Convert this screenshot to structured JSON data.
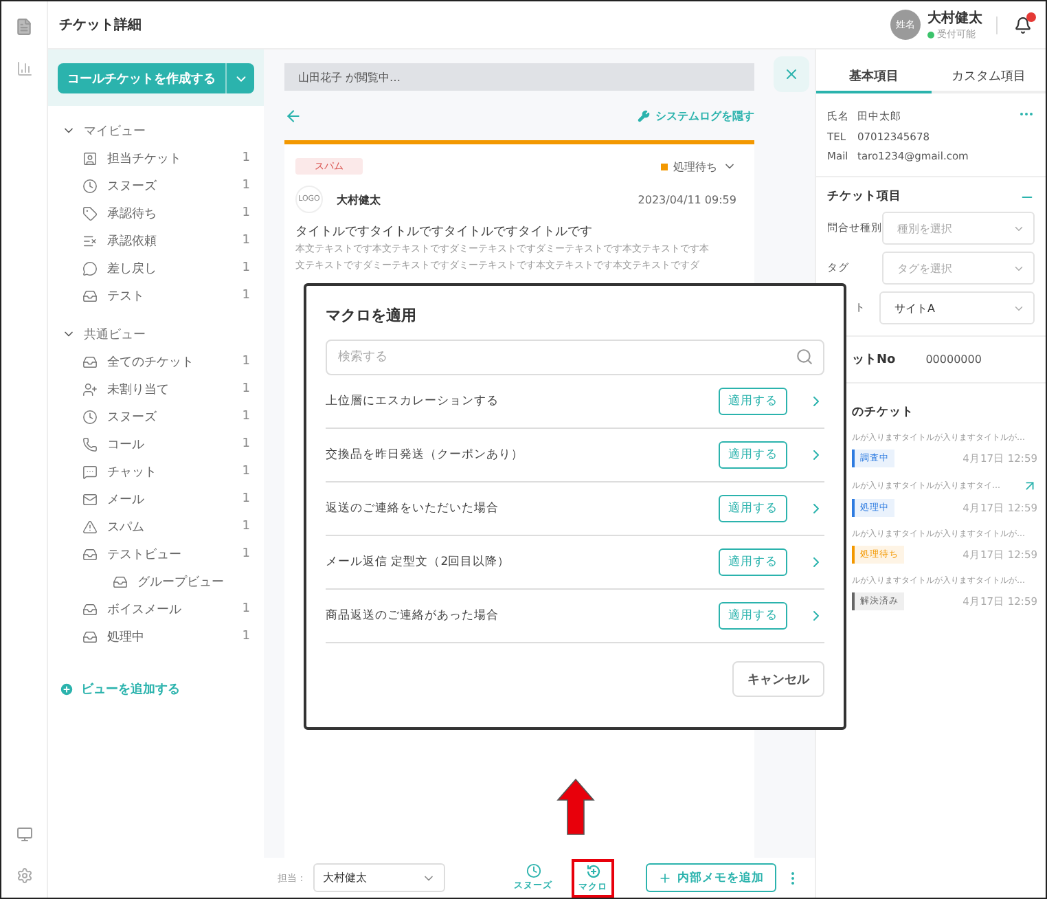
{
  "header": {
    "title": "チケット詳細",
    "user": {
      "avatar_text": "姓名",
      "name": "大村健太",
      "status": "受付可能"
    },
    "notification_unread": true
  },
  "sidebar": {
    "create_button": "コールチケットを作成する",
    "sections": [
      {
        "title": "マイビュー",
        "expanded": true,
        "items": [
          {
            "kind": "assigned",
            "label": "担当チケット",
            "count": "1"
          },
          {
            "kind": "snooze",
            "label": "スヌーズ",
            "count": "1"
          },
          {
            "kind": "pending",
            "label": "承認待ち",
            "count": "1"
          },
          {
            "kind": "request",
            "label": "承認依頼",
            "count": "1"
          },
          {
            "kind": "returned",
            "label": "差し戻し",
            "count": "1"
          },
          {
            "kind": "inbox",
            "label": "テスト",
            "count": "1"
          }
        ]
      },
      {
        "title": "共通ビュー",
        "expanded": true,
        "items": [
          {
            "kind": "all",
            "label": "全てのチケット",
            "count": "1"
          },
          {
            "kind": "unassigned",
            "label": "未割り当て",
            "count": "1"
          },
          {
            "kind": "snooze",
            "label": "スヌーズ",
            "count": "1"
          },
          {
            "kind": "call",
            "label": "コール",
            "count": "1"
          },
          {
            "kind": "chat",
            "label": "チャット",
            "count": "1"
          },
          {
            "kind": "mail",
            "label": "メール",
            "count": "1"
          },
          {
            "kind": "spam",
            "label": "スパム",
            "count": "1"
          },
          {
            "kind": "inbox",
            "label": "テストビュー",
            "count": "1",
            "children": [
              {
                "kind": "inbox",
                "label": "グループビュー"
              }
            ]
          },
          {
            "kind": "inbox",
            "label": "ボイスメール",
            "count": "1"
          },
          {
            "kind": "inbox",
            "label": "処理中",
            "count": "1"
          }
        ]
      }
    ],
    "add_view": "ビューを追加する"
  },
  "ticket": {
    "viewing_notice": "山田花子 が閲覧中…",
    "system_log_link": "システムログを隠す",
    "tag": "スパム",
    "status": {
      "label": "処理待ち",
      "color": "#f39800"
    },
    "logo_text": "LOGO",
    "sender": "大村健太",
    "date": "2023/04/11 09:59",
    "title": "タイトルですタイトルですタイトルですタイトルです",
    "body_lines": [
      "本文テキストです本文テキストですダミーテキストですダミーテキストです本文テキストです本",
      "文テキストですダミーテキストですダミーテキストです本文テキストです本文テキストですダ"
    ]
  },
  "modal": {
    "title": "マクロを適用",
    "search": {
      "placeholder": "検索する"
    },
    "macros": [
      {
        "label": "上位層にエスカレーションする",
        "button": "適用する"
      },
      {
        "label": "交換品を昨日発送（クーポンあり）",
        "button": "適用する"
      },
      {
        "label": "返送のご連絡をいただいた場合",
        "button": "適用する"
      },
      {
        "label": "メール返信 定型文（2回目以降）",
        "button": "適用する"
      },
      {
        "label": "商品返送のご連絡があった場合",
        "button": "適用する"
      }
    ],
    "cancel": "キャンセル"
  },
  "bottom_bar": {
    "assignee_label": "担当：",
    "assignee": "大村健太",
    "snooze": "スヌーズ",
    "macro": "マクロ",
    "macro_highlighted": true,
    "add_memo": "内部メモを追加"
  },
  "right_panel": {
    "tabs": [
      {
        "label": "基本項目",
        "selected": true
      },
      {
        "label": "カスタム項目",
        "selected": false
      }
    ],
    "contact": [
      {
        "label": "氏名",
        "value": "田中太郎"
      },
      {
        "label": "TEL",
        "value": "07012345678"
      },
      {
        "label": "Mail",
        "value": "taro1234@gmail.com"
      }
    ],
    "ticket_fields": {
      "title": "チケット項目",
      "expanded": true,
      "fields": [
        {
          "label": "問合せ種別",
          "placeholder": "種別を選択"
        },
        {
          "label": "タグ",
          "placeholder": "タグを選択"
        },
        {
          "label": "ト",
          "value": "サイトA"
        }
      ]
    },
    "ticket_no": {
      "label": "ットNo",
      "value": "00000000"
    },
    "related": {
      "title": "のチケット",
      "tickets": [
        {
          "title": "ルが入りますタイトルが入りますタイトルが…",
          "status": "調査中",
          "color": "#2d7be0",
          "date": "4月17日 12:59",
          "linked": false
        },
        {
          "title": "ルが入りますタイトルが入りますタイ…",
          "status": "処理中",
          "color": "#2d7be0",
          "date": "4月17日 12:59",
          "linked": true
        },
        {
          "title": "ルが入りますタイトルが入りますタイトルが…",
          "status": "処理待ち",
          "color": "#f39800",
          "date": "4月17日 12:59",
          "linked": false
        },
        {
          "title": "ルが入りますタイトルが入りますタイトルが…",
          "status": "解決済み",
          "color": "#666666",
          "date": "4月17日 12:59",
          "linked": false
        }
      ]
    }
  }
}
